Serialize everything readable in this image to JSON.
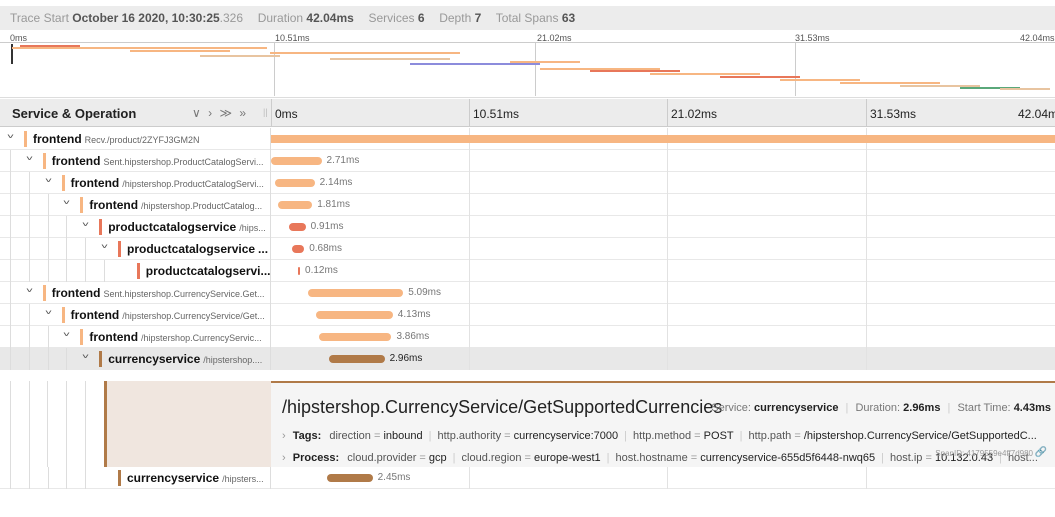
{
  "header": {
    "trace_start_label": "Trace Start",
    "trace_start_date": "October 16 2020, 10:30:25",
    "trace_start_ms": ".326",
    "duration_label": "Duration",
    "duration": "42.04ms",
    "services_label": "Services",
    "services": "6",
    "depth_label": "Depth",
    "depth": "7",
    "total_spans_label": "Total Spans",
    "total_spans": "63"
  },
  "minimap": {
    "ticks": [
      "0ms",
      "10.51ms",
      "21.02ms",
      "31.53ms",
      "42.04ms"
    ]
  },
  "columns": {
    "service_operation": "Service & Operation",
    "controls": "∨ › ≫ »",
    "ticks": [
      "0ms",
      "10.51ms",
      "21.02ms",
      "31.53ms",
      "42.04ms"
    ]
  },
  "rows": [
    {
      "service": "frontend",
      "op": "Recv./product/2ZYFJ3GM2N",
      "duration": "",
      "color": "#f7b682",
      "start": 0.0,
      "dur": 42.04,
      "expandable": true
    },
    {
      "service": "frontend",
      "op": "Sent.hipstershop.ProductCatalogServi...",
      "duration": "2.71ms",
      "color": "#f7b682",
      "start": 0.0,
      "dur": 2.71,
      "expandable": true
    },
    {
      "service": "frontend",
      "op": "/hipstershop.ProductCatalogServi...",
      "duration": "2.14ms",
      "color": "#f7b682",
      "start": 0.2,
      "dur": 2.14,
      "expandable": true
    },
    {
      "service": "frontend",
      "op": "/hipstershop.ProductCatalog...",
      "duration": "1.81ms",
      "color": "#f7b682",
      "start": 0.4,
      "dur": 1.81,
      "expandable": true
    },
    {
      "service": "productcatalogservice",
      "op": "/hips...",
      "duration": "0.91ms",
      "color": "#e8775a",
      "start": 0.95,
      "dur": 0.91,
      "expandable": true
    },
    {
      "service": "productcatalogservice",
      "op": "...",
      "duration": "0.68ms",
      "color": "#e8775a",
      "start": 1.1,
      "dur": 0.68,
      "expandable": true
    },
    {
      "service": "productcatalogservi...",
      "op": "",
      "duration": "0.12ms",
      "color": "#e8775a",
      "start": 1.45,
      "dur": 0.12,
      "expandable": false
    },
    {
      "service": "frontend",
      "op": "Sent.hipstershop.CurrencyService.Get...",
      "duration": "5.09ms",
      "color": "#f7b682",
      "start": 2.0,
      "dur": 5.09,
      "expandable": true
    },
    {
      "service": "frontend",
      "op": "/hipstershop.CurrencyService/Get...",
      "duration": "4.13ms",
      "color": "#f7b682",
      "start": 2.4,
      "dur": 4.13,
      "expandable": true
    },
    {
      "service": "frontend",
      "op": "/hipstershop.CurrencyServic...",
      "duration": "3.86ms",
      "color": "#f7b682",
      "start": 2.6,
      "dur": 3.86,
      "expandable": true
    },
    {
      "service": "currencyservice",
      "op": "/hipstershop....",
      "duration": "2.96ms",
      "color": "#b07a48",
      "start": 3.13,
      "dur": 2.96,
      "expandable": true,
      "selected": true
    },
    {
      "service": "currencyservice",
      "op": "/hipsters...",
      "duration": "2.45ms",
      "color": "#b07a48",
      "start": 3.0,
      "dur": 2.45,
      "expandable": false
    }
  ],
  "detail": {
    "title": "/hipstershop.CurrencyService/GetSupportedCurrencies",
    "service_label": "Service:",
    "service": "currencyservice",
    "duration_label": "Duration:",
    "duration": "2.96ms",
    "start_label": "Start Time:",
    "start": "4.43ms",
    "tags_label": "Tags:",
    "tags": [
      {
        "k": "direction",
        "v": "inbound"
      },
      {
        "k": "http.authority",
        "v": "currencyservice:7000"
      },
      {
        "k": "http.method",
        "v": "POST"
      },
      {
        "k": "http.path",
        "v": "/hipstershop.CurrencyService/GetSupportedC..."
      }
    ],
    "process_label": "Process:",
    "process": [
      {
        "k": "cloud.provider",
        "v": "gcp"
      },
      {
        "k": "cloud.region",
        "v": "europe-west1"
      },
      {
        "k": "host.hostname",
        "v": "currencyservice-655d5f6448-nwq65"
      },
      {
        "k": "host.ip",
        "v": "10.132.0.43"
      },
      {
        "k": "host...",
        "v": ""
      }
    ],
    "span_id": "SpanID: 4179559e4ff7d980"
  }
}
